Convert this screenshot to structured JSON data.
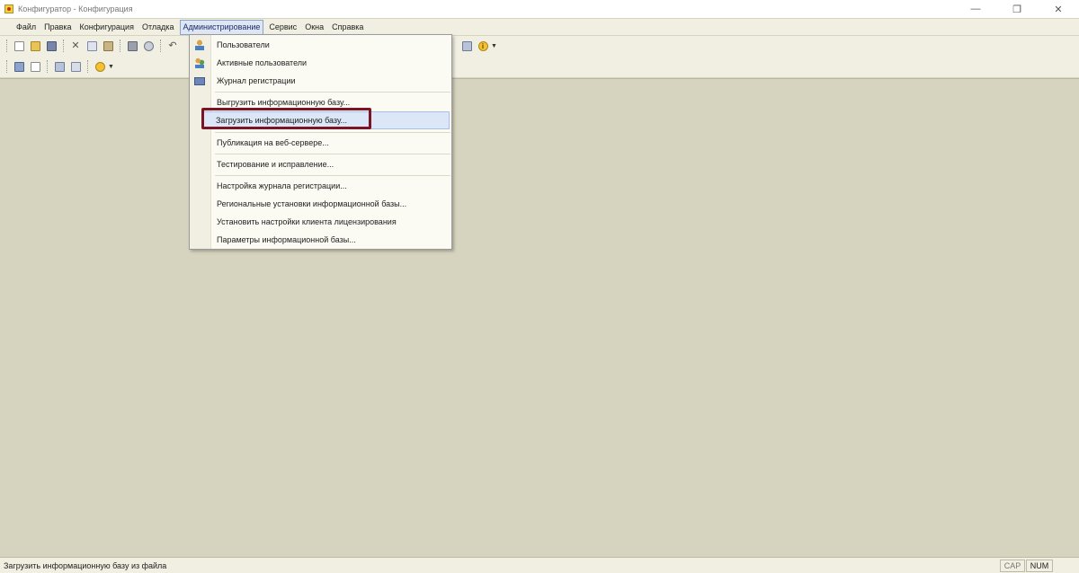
{
  "window": {
    "title": "Конфигуратор - Конфигурация",
    "controls": [
      "minimize-icon",
      "restore-icon",
      "close-icon"
    ]
  },
  "menubar": {
    "items": [
      {
        "label": "Файл"
      },
      {
        "label": "Правка"
      },
      {
        "label": "Конфигурация"
      },
      {
        "label": "Отладка"
      },
      {
        "label": "Администрирование",
        "active": true
      },
      {
        "label": "Сервис"
      },
      {
        "label": "Окна"
      },
      {
        "label": "Справка"
      }
    ]
  },
  "admin_menu": {
    "items": [
      {
        "label": "Пользователи",
        "icon": "user-icon"
      },
      {
        "label": "Активные пользователи",
        "icon": "users-icon"
      },
      {
        "label": "Журнал регистрации",
        "icon": "journal-icon"
      },
      {
        "label": "Выгрузить информационную базу...",
        "separator_before": true
      },
      {
        "label": "Загрузить информационную базу...",
        "highlighted": true
      },
      {
        "label": "Публикация на веб-сервере...",
        "separator_before": true
      },
      {
        "label": "Тестирование и исправление...",
        "separator_before": true
      },
      {
        "label": "Настройка журнала регистрации...",
        "separator_before": true
      },
      {
        "label": "Региональные установки информационной базы..."
      },
      {
        "label": "Установить настройки клиента лицензирования"
      },
      {
        "label": "Параметры информационной базы..."
      }
    ]
  },
  "statusbar": {
    "text": "Загрузить информационную базу из файла",
    "cap": "CAP",
    "num": "NUM"
  },
  "colors": {
    "workspace": "#d6d3be",
    "menu_bg": "#fbfaf3",
    "highlight_frame": "#7a1426",
    "selection": "#dbe6f7"
  }
}
